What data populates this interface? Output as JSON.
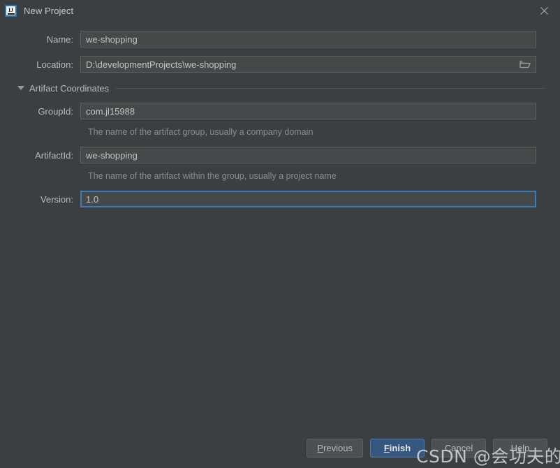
{
  "window": {
    "title": "New Project",
    "app_icon": "intellij-idea-icon",
    "close_icon": "close-icon"
  },
  "form": {
    "name": {
      "label": "Name:",
      "value": "we-shopping"
    },
    "location": {
      "label": "Location:",
      "value": "D:\\developmentProjects\\we-shopping",
      "browse_icon": "folder-browse-icon"
    },
    "artifact_coordinates": {
      "section_label": "Artifact Coordinates",
      "expanded": true,
      "collapse_icon": "triangle-down-icon",
      "group_id": {
        "label": "GroupId:",
        "value": "com.jl15988",
        "helper": "The name of the artifact group, usually a company domain"
      },
      "artifact_id": {
        "label": "ArtifactId:",
        "value": "we-shopping",
        "helper": "The name of the artifact within the group, usually a project name"
      },
      "version": {
        "label": "Version:",
        "value": "1.0",
        "focused": true
      }
    }
  },
  "buttons": {
    "previous": {
      "label": "Previous",
      "mnemonic": "P"
    },
    "finish": {
      "label": "Finish",
      "mnemonic": "F",
      "primary": true
    },
    "cancel": {
      "label": "Cancel"
    },
    "help": {
      "label": "Help"
    }
  },
  "watermark": {
    "text": "CSDN @会功夫的李白"
  },
  "colors": {
    "background": "#3c3f41",
    "field_background": "#45494a",
    "field_border": "#5e6060",
    "focus_border": "#3d7ab8",
    "primary_button": "#365880",
    "text": "#bbbbbb",
    "helper_text": "#8c8c8c"
  }
}
